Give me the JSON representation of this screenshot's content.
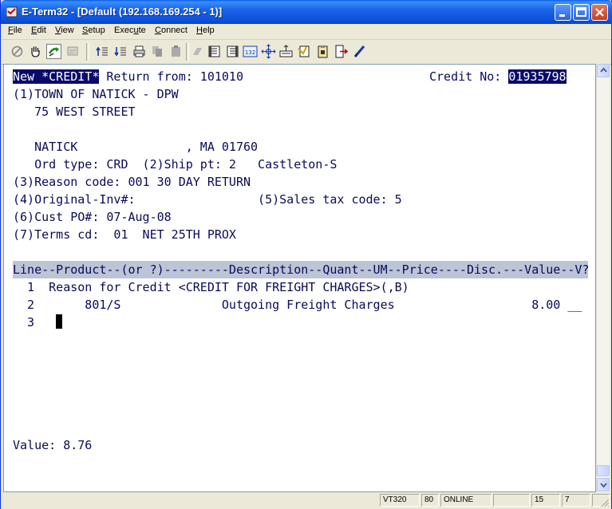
{
  "window": {
    "title": "E-Term32 - [Default (192.168.169.254 - 1)]"
  },
  "menu": {
    "items": [
      {
        "acc": "F",
        "rest": "ile"
      },
      {
        "acc": "E",
        "rest": "dit"
      },
      {
        "acc": "V",
        "rest": "iew"
      },
      {
        "acc": "S",
        "rest": "etup"
      },
      {
        "pre": "Exec",
        "acc": "u",
        "rest": "te"
      },
      {
        "acc": "C",
        "rest": "onnect"
      },
      {
        "acc": "H",
        "rest": "elp"
      }
    ]
  },
  "toolbar": {
    "icons": [
      "stop-icon",
      "hand-icon",
      "connect-icon",
      "disconnect-icon",
      "send-file-icon",
      "receive-file-icon",
      "print-icon",
      "copy-icon",
      "paste-icon",
      "erase-icon",
      "page-icon",
      "page-alt-icon",
      "vt-132-icon",
      "move-icon",
      "keyboard-icon",
      "script-icon",
      "clipboard-icon",
      "exit-icon",
      "edit-icon"
    ],
    "vt132_label": "132"
  },
  "terminal": {
    "mode_label": "New *CREDIT*",
    "return_from": " Return from: 101010",
    "credit_no_label": "Credit No: ",
    "credit_no_value": "01935798",
    "line_customer": "(1)TOWN OF NATICK - DPW",
    "line_address": "   75 WEST STREET",
    "line_city": "   NATICK               , MA 01760",
    "line_ordtype": "   Ord type: CRD  (2)Ship pt: 2   Castleton-S",
    "line_reason": "(3)Reason code: 001 30 DAY RETURN",
    "line_orig_inv": "(4)Original-Inv#:                 (5)Sales tax code: 5",
    "line_cust_po": "(6)Cust PO#: 07-Aug-08",
    "line_terms": "(7)Terms cd:  01  NET 25TH PROX",
    "grid_header": "Line--Product--(or ?)---------Description--Quant--UM--Price----Disc.---Value--V?",
    "grid_rows": [
      "  1  Reason for Credit <CREDIT FOR FREIGHT CHARGES>(,B)",
      "  2       801/S              Outgoing Freight Charges                   8.00 __",
      "  3  "
    ],
    "total_line": "Value: 8.76"
  },
  "status": {
    "emulation": "VT320",
    "columns": "80",
    "connection": "ONLINE",
    "row": "15",
    "col": "7"
  },
  "colors": {
    "terminal_text": "#0a0a5a",
    "highlight_bg": "#0a0a6a",
    "header_bar": "#bcc5d6",
    "titlebar": "#0b4fd9"
  }
}
